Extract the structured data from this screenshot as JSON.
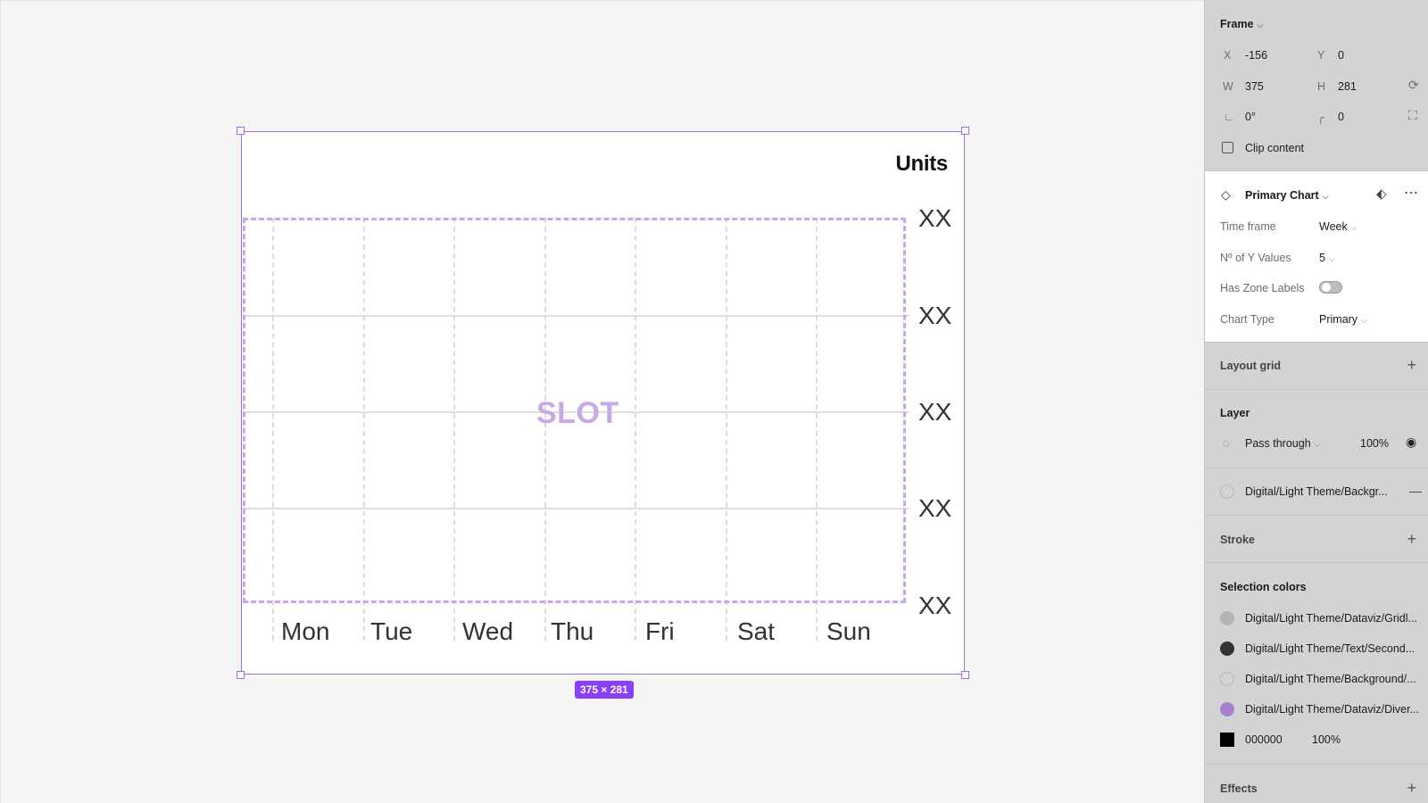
{
  "chart": {
    "units_label": "Units",
    "y_labels": [
      "XX",
      "XX",
      "XX",
      "XX",
      "XX"
    ],
    "x_labels": [
      "Mon",
      "Tue",
      "Wed",
      "Thu",
      "Fri",
      "Sat",
      "Sun"
    ],
    "slot_label": "SLOT",
    "size_badge": "375 × 281"
  },
  "panel": {
    "frame": {
      "title": "Frame",
      "x_label": "X",
      "x_value": "-156",
      "y_label": "Y",
      "y_value": "0",
      "w_label": "W",
      "w_value": "375",
      "h_label": "H",
      "h_value": "281",
      "rotation_value": "0°",
      "radius_value": "0",
      "clip_label": "Clip content"
    },
    "component": {
      "name": "Primary Chart",
      "props": [
        {
          "label": "Time frame",
          "value": "Week"
        },
        {
          "label": "Nº of Y Values",
          "value": "5"
        },
        {
          "label": "Has Zone Labels",
          "value": ""
        },
        {
          "label": "Chart Type",
          "value": "Primary"
        }
      ]
    },
    "layout_grid": {
      "title": "Layout grid"
    },
    "layer": {
      "title": "Layer",
      "blend": "Pass through",
      "opacity": "100%"
    },
    "fill": {
      "name": "Digital/Light Theme/Backgr..."
    },
    "stroke": {
      "title": "Stroke"
    },
    "selection_colors": {
      "title": "Selection colors",
      "items": [
        {
          "name": "Digital/Light Theme/Dataviz/Gridl...",
          "color": "#b3b3b3"
        },
        {
          "name": "Digital/Light Theme/Text/Second...",
          "color": "#333333"
        },
        {
          "name": "Digital/Light Theme/Background/...",
          "color": "#d3d3d3"
        },
        {
          "name": "Digital/Light Theme/Dataviz/Diver...",
          "color": "#a77fd0"
        }
      ],
      "hex_item": {
        "hex": "000000",
        "opacity": "100%",
        "color": "#000000"
      }
    },
    "effects": {
      "title": "Effects"
    }
  }
}
